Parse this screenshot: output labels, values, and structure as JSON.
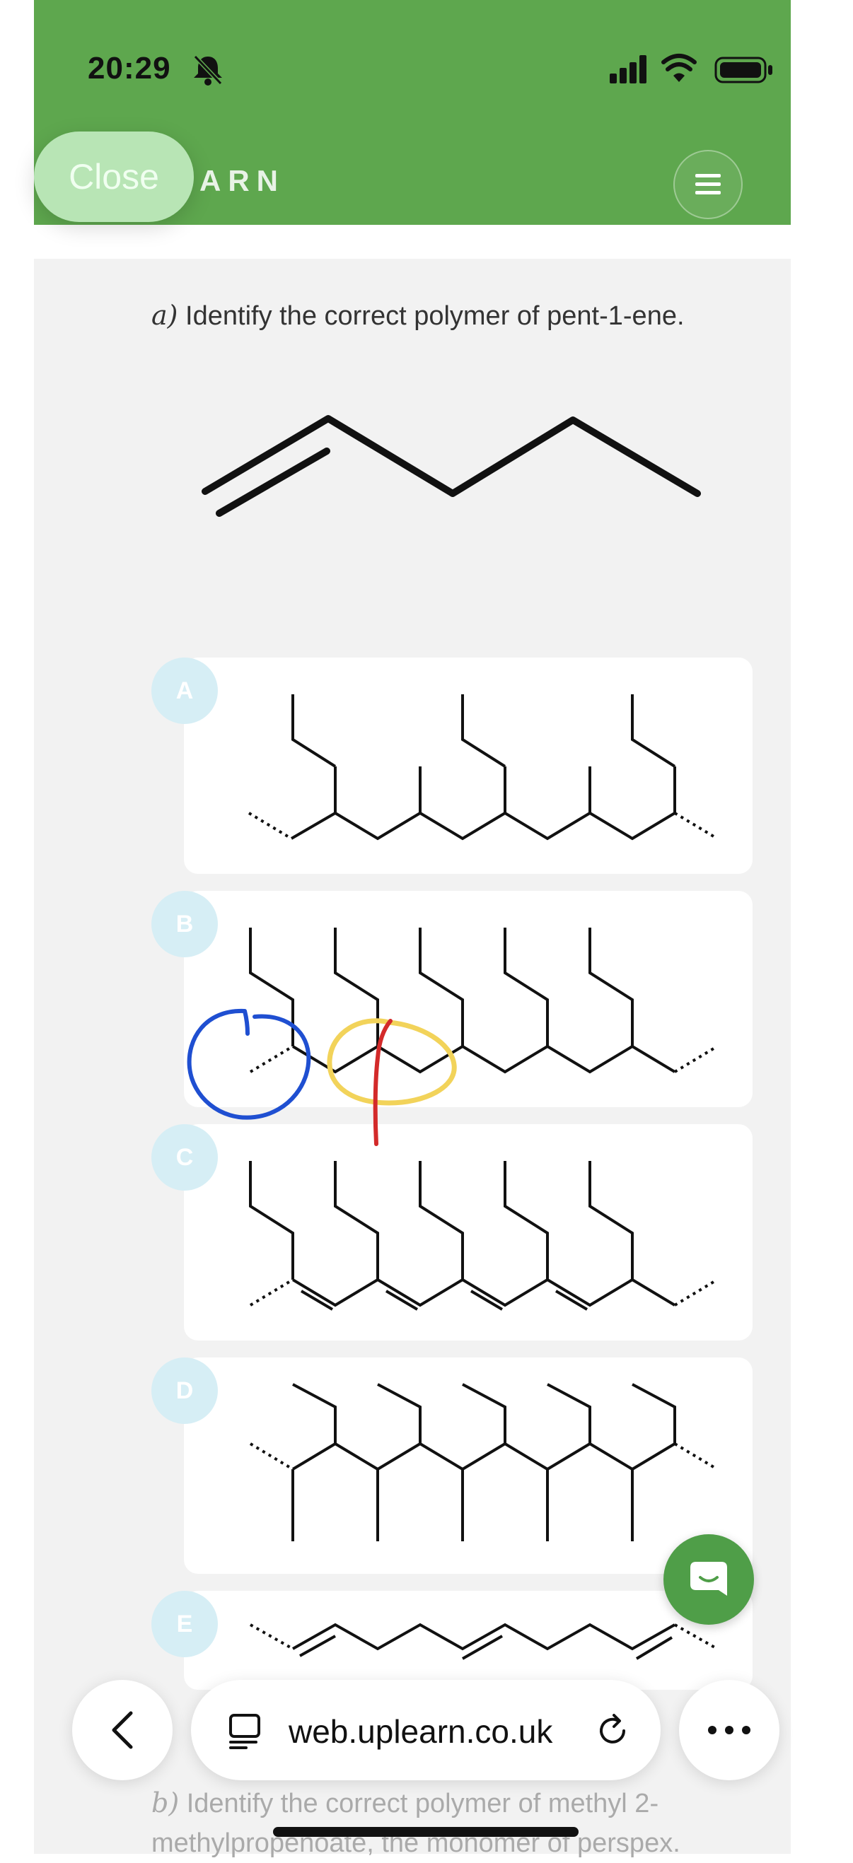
{
  "status_bar": {
    "time": "20:29"
  },
  "header": {
    "close_label": "Close",
    "brand_partial": "ARN"
  },
  "question_a": {
    "letter": "a)",
    "text": "Identify the correct polymer of pent-1-ene."
  },
  "options": [
    {
      "label": "A"
    },
    {
      "label": "B"
    },
    {
      "label": "C"
    },
    {
      "label": "D"
    },
    {
      "label": "E"
    }
  ],
  "browser": {
    "url": "web.uplearn.co.uk"
  },
  "question_b": {
    "letter": "b)",
    "text": "Identify the correct polymer of methyl 2-methylpropenoate, the monomer of perspex."
  },
  "colors": {
    "header_green": "#5ea74e",
    "badge": "#d6eef5",
    "annotation_blue": "#1f4fd1",
    "annotation_yellow": "#f2d35a",
    "annotation_red": "#d32a2a"
  },
  "icons": [
    "bell-slash-icon",
    "signal-icon",
    "wifi-icon",
    "battery-icon",
    "menu-icon",
    "chat-icon",
    "back-chevron-icon",
    "tabs-icon",
    "reload-icon",
    "more-icon"
  ]
}
